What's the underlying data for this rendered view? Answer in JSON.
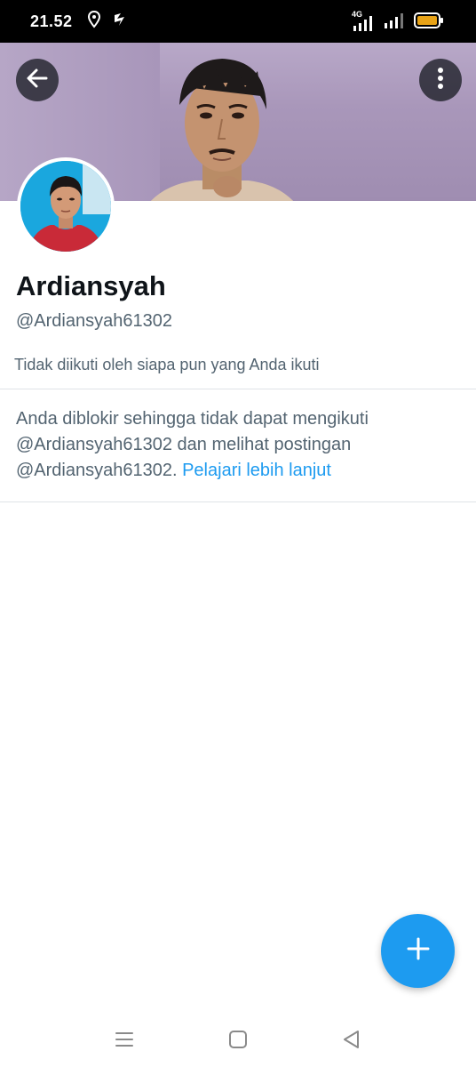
{
  "status_bar": {
    "time": "21.52",
    "network": "4G",
    "icons": [
      "location-icon",
      "cast-icon",
      "signal-4g-icon",
      "signal-icon",
      "battery-icon"
    ],
    "battery_color": "#e8a317"
  },
  "header": {
    "back_icon": "arrow-left-icon",
    "more_icon": "more-vertical-icon"
  },
  "profile": {
    "display_name": "Ardiansyah",
    "handle": "@Ardiansyah61302",
    "followed_by_text": "Tidak diikuti oleh siapa pun yang Anda ikuti",
    "blocked_message": "Anda diblokir sehingga tidak dapat mengikuti @Ardiansyah61302 dan melihat postingan @Ardiansyah61302.",
    "learn_more_label": "Pelajari lebih lanjut"
  },
  "fab": {
    "icon": "plus-icon",
    "color": "#1d9bf0"
  },
  "nav_bar": {
    "icons": [
      "menu-icon",
      "home-square-icon",
      "back-triangle-icon"
    ]
  },
  "colors": {
    "accent": "#1d9bf0",
    "text_primary": "#0f1419",
    "text_secondary": "#536471"
  }
}
